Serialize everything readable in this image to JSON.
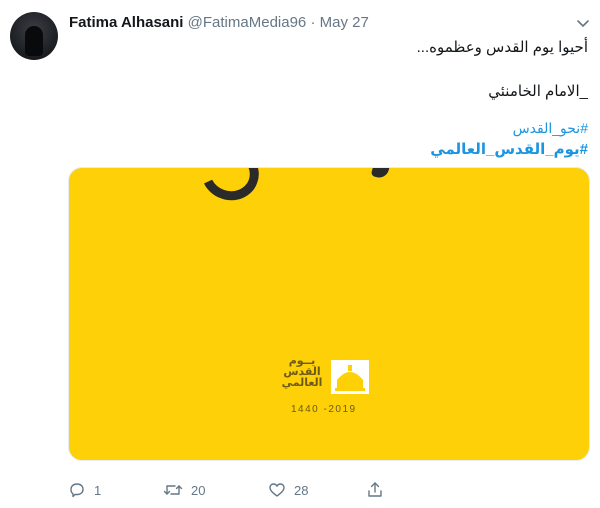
{
  "tweet": {
    "user": {
      "name": "Fatima Alhasani",
      "handle": "@FatimaMedia96",
      "separator": "·",
      "date": "May 27"
    },
    "text": {
      "line1": "أحيوا يوم القدس وعظموه...",
      "line2": "_الامام الخامنئي",
      "hashtag1": "#نحو_القدس",
      "hashtag2": "#يوم_القدس_العالمي"
    },
    "media": {
      "background_color": "#fdd007",
      "logo_text": [
        "يــوم",
        "القدس",
        "العالمي"
      ],
      "logo_years": "1440 -2019"
    },
    "actions": {
      "reply_count": "1",
      "retweet_count": "20",
      "like_count": "28"
    },
    "icons": {
      "reply": "reply-icon",
      "retweet": "retweet-icon",
      "like": "heart-icon",
      "share": "share-icon",
      "menu": "chevron-down-icon"
    },
    "colors": {
      "link": "#1b95e0",
      "secondary": "#657786",
      "text": "#14171a"
    }
  }
}
